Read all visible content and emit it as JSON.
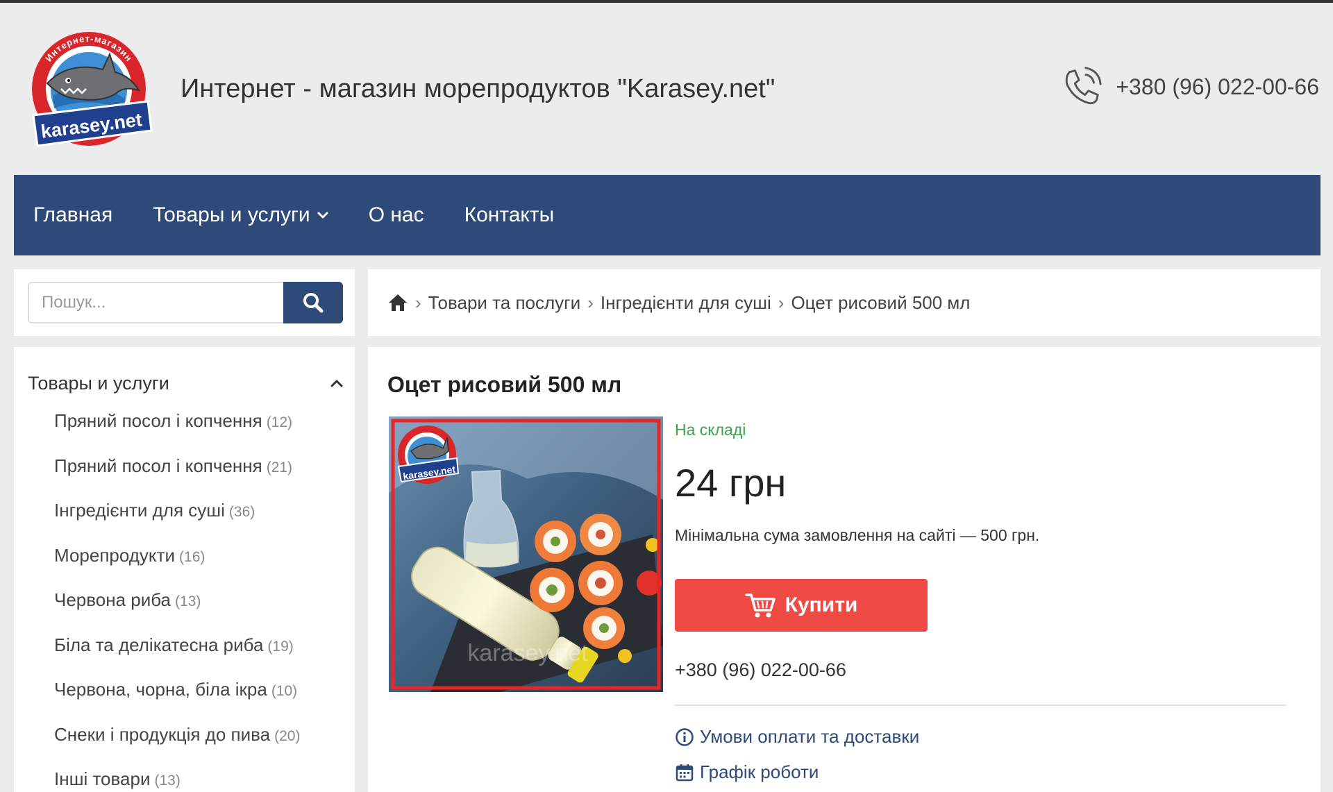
{
  "header": {
    "logo_text": "karasey.net",
    "logo_ring_text": "Интернет-магазин",
    "site_title": "Интернет - магазин морепродуктов \"Karasey.net\"",
    "phone": "+380 (96) 022-00-66"
  },
  "nav": {
    "items": [
      {
        "label": "Главная"
      },
      {
        "label": "Товары и услуги",
        "has_dropdown": true
      },
      {
        "label": "О нас"
      },
      {
        "label": "Контакты"
      }
    ]
  },
  "search": {
    "placeholder": "Пошук...",
    "value": ""
  },
  "breadcrumb": {
    "items": [
      "Товари та послуги",
      "Інгредієнти для суші",
      "Оцет рисовий 500 мл"
    ]
  },
  "sidebar": {
    "title": "Товары и услуги",
    "items": [
      {
        "label": "Пряний посол і копчення",
        "count": "(12)"
      },
      {
        "label": "Пряний посол і копчення",
        "count": "(21)"
      },
      {
        "label": "Інгредієнти для суші",
        "count": "(36)"
      },
      {
        "label": "Морепродукти",
        "count": "(16)"
      },
      {
        "label": "Червона риба",
        "count": "(13)"
      },
      {
        "label": "Біла та делікатесна риба",
        "count": "(19)"
      },
      {
        "label": "Червона, чорна, біла ікра",
        "count": "(10)"
      },
      {
        "label": "Снеки і продукція до пива",
        "count": "(20)"
      },
      {
        "label": "Інші товари",
        "count": "(13)"
      }
    ]
  },
  "product": {
    "title": "Оцет рисовий 500 мл",
    "stock": "На складі",
    "price": "24 грн",
    "min_sum": "Мінімальна сума замовлення на сайті — 500 грн.",
    "buy_label": "Купити",
    "phone": "+380 (96) 022-00-66",
    "watermark": "karasey.net",
    "links": {
      "payment": "Умови оплати та доставки",
      "schedule": "Графік роботи"
    }
  },
  "colors": {
    "brand_blue": "#2d4a78",
    "buy_red": "#ef4b44",
    "stock_green": "#3aa54a"
  }
}
